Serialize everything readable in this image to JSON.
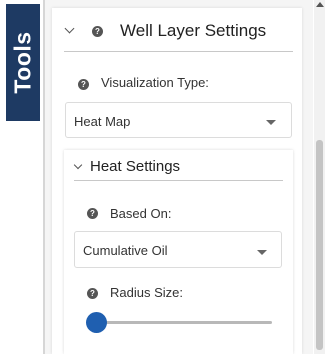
{
  "tools_tab": {
    "label": "Tools"
  },
  "panel": {
    "title": "Well Layer Settings",
    "visualization": {
      "label": "Visualization Type:",
      "selected": "Heat Map"
    },
    "heat_settings": {
      "title": "Heat Settings",
      "based_on": {
        "label": "Based On:",
        "selected": "Cumulative Oil"
      },
      "radius": {
        "label": "Radius Size:",
        "value_fraction": 0.0
      }
    }
  },
  "icons": {
    "help": "?",
    "collapse": "chevron-down-icon"
  },
  "colors": {
    "tools_tab_bg": "#1e3a63",
    "slider_thumb": "#1f5fb0"
  }
}
